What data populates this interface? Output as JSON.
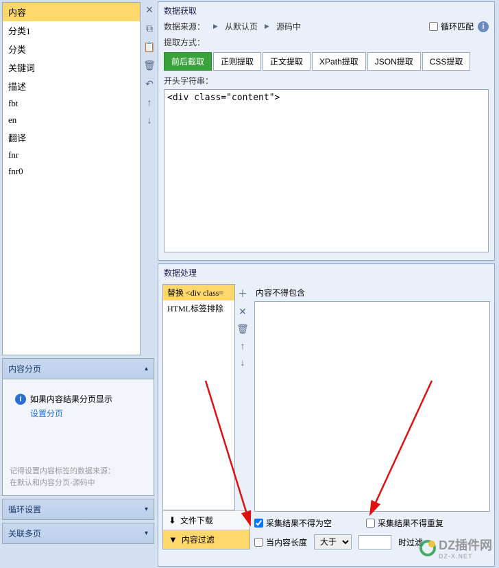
{
  "fields": {
    "items": [
      "内容",
      "分类1",
      "分类",
      "关键词",
      "描述",
      "fbt",
      "en",
      "翻译",
      "fnr",
      "fnr0"
    ],
    "selected_index": 0
  },
  "left_toolbar": {
    "icons": [
      "close-icon",
      "copy-icon",
      "paste-icon",
      "delete-icon",
      "undo-icon",
      "move-up-icon",
      "move-down-icon"
    ]
  },
  "content_paging": {
    "title": "内容分页",
    "info_text": "如果内容结果分页显示",
    "link_text": "设置分页",
    "hint_line1": "记得设置内容标签的数据来源：",
    "hint_line2": "在默认和内容分页-源码中"
  },
  "loop_settings": {
    "title": "循环设置"
  },
  "related_pages": {
    "title": "关联多页"
  },
  "data_extract": {
    "title": "数据获取",
    "source_label": "数据来源：",
    "crumb1": "从默认页",
    "crumb2": "源码中",
    "loop_match_label": "循环匹配",
    "extract_method_label": "提取方式：",
    "tabs": [
      "前后截取",
      "正则提取",
      "正文提取",
      "XPath提取",
      "JSON提取",
      "CSS提取"
    ],
    "active_tab": 0,
    "start_string_label": "开头字符串：",
    "start_string_value": "<div class=\"content\">"
  },
  "data_process": {
    "title": "数据处理",
    "items": [
      "替换 <div class=",
      "HTML标签排除"
    ],
    "selected_index": 0,
    "toolbar_icons": [
      "add-icon",
      "close-icon",
      "delete-icon",
      "move-up-icon",
      "move-down-icon"
    ],
    "bottom_tabs": {
      "download": "文件下载",
      "filter": "内容过滤",
      "active": "filter"
    },
    "exclude_label": "内容不得包含",
    "result_not_empty": "采集结果不得为空",
    "result_not_empty_checked": true,
    "result_no_duplicate": "采集结果不得重复",
    "result_no_duplicate_checked": false,
    "when_length_label": "当内容长度",
    "when_length_checked": false,
    "compare_options": [
      "大于"
    ],
    "compare_selected": "大于",
    "length_value": "",
    "when_filter_label": "时过滤"
  },
  "watermark": {
    "main": "DZ插件网",
    "sub": "DZ-X.NET"
  }
}
